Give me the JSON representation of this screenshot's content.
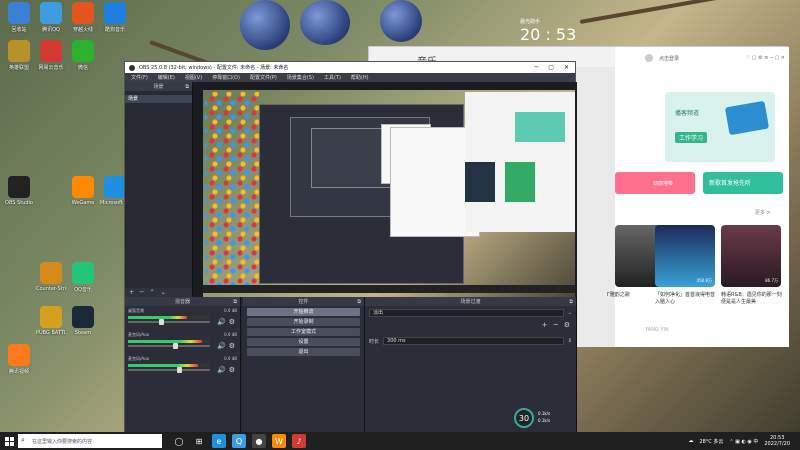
{
  "desktop": {
    "icons": [
      {
        "label": "回收站",
        "color": "#3b7fd6"
      },
      {
        "label": "腾讯QQ",
        "color": "#3d9de0"
      },
      {
        "label": "穿越火线",
        "color": "#e25520"
      },
      {
        "label": "酷狗音乐",
        "color": "#1e7fe0"
      },
      {
        "label": "英雄联盟",
        "color": "#b8902a"
      },
      {
        "label": "网易云音乐",
        "color": "#d33a31"
      },
      {
        "label": "微信",
        "color": "#2bb12b"
      },
      {
        "label": "OBS Studio",
        "color": "#222"
      },
      {
        "label": "WeGame",
        "color": "#ff8a00"
      },
      {
        "label": "Microsoft Edge",
        "color": "#1f8fe0"
      },
      {
        "label": "Steam",
        "color": "#1b2838"
      },
      {
        "label": "Counter-Strike Global ...",
        "color": "#d58a1a"
      },
      {
        "label": "PUBG BATTLEGR...",
        "color": "#d5a020"
      },
      {
        "label": "QQ音乐",
        "color": "#22c57a"
      },
      {
        "label": "腾讯视频",
        "color": "#ff7a1a"
      }
    ]
  },
  "clock_widget": {
    "label": "晨光助手",
    "time": "20 : 53"
  },
  "music_app": {
    "title": "音乐",
    "header_user": "点击登录",
    "card_title": "播客频道",
    "card_tag": "工作学习",
    "pink_label": "动感地带",
    "green_label": "新歌首发抢先听",
    "more_link": "更多 >",
    "singers": [
      {
        "caption": "Γ雅韵之歌",
        "likes": ""
      },
      {
        "caption": "「如何净化」首首浪得电音入脑入心",
        "likes": "450.8万"
      },
      {
        "caption": "韩语R&B：遇见你的那一刻便是是人生最美",
        "likes": "86.7万"
      }
    ],
    "footer": "YANG YIN"
  },
  "obs": {
    "window_title": "OBS 25.0.8 (32-bit, windows) - 配置文件: 未命名 - 场景: 未命名",
    "menu": [
      "文件(F)",
      "编辑(E)",
      "视图(V)",
      "停靠窗口(D)",
      "配置文件(P)",
      "场景集合(S)",
      "工具(T)",
      "帮助(H)"
    ],
    "scenes_title": "场景",
    "scene_item": "场景",
    "mixer_title": "混音器",
    "channels": [
      {
        "name": "桌面音频",
        "db": "0.0 dB",
        "level": 0.72,
        "fader": 0.38
      },
      {
        "name": "麦克风/Aux",
        "db": "0.0 dB",
        "level": 0.9,
        "fader": 0.55
      },
      {
        "name": "麦克风/Aux",
        "db": "0.0 dB",
        "level": 0.85,
        "fader": 0.6
      }
    ],
    "controls_title": "控件",
    "controls": [
      "开始推流",
      "开始录制",
      "工作室模式",
      "设置",
      "退出"
    ],
    "transition_title": "场景过渡",
    "transition_value": "淡出",
    "duration_label": "时长",
    "duration_value": "300 ms",
    "cpu": "30",
    "up_speed": "0.1k/s",
    "down_speed": "0.1k/s"
  },
  "taskbar": {
    "search_placeholder": "在这里输入你要搜索的内容",
    "weather": "28°C 多云",
    "time": "20:53",
    "date": "2022/7/20"
  }
}
